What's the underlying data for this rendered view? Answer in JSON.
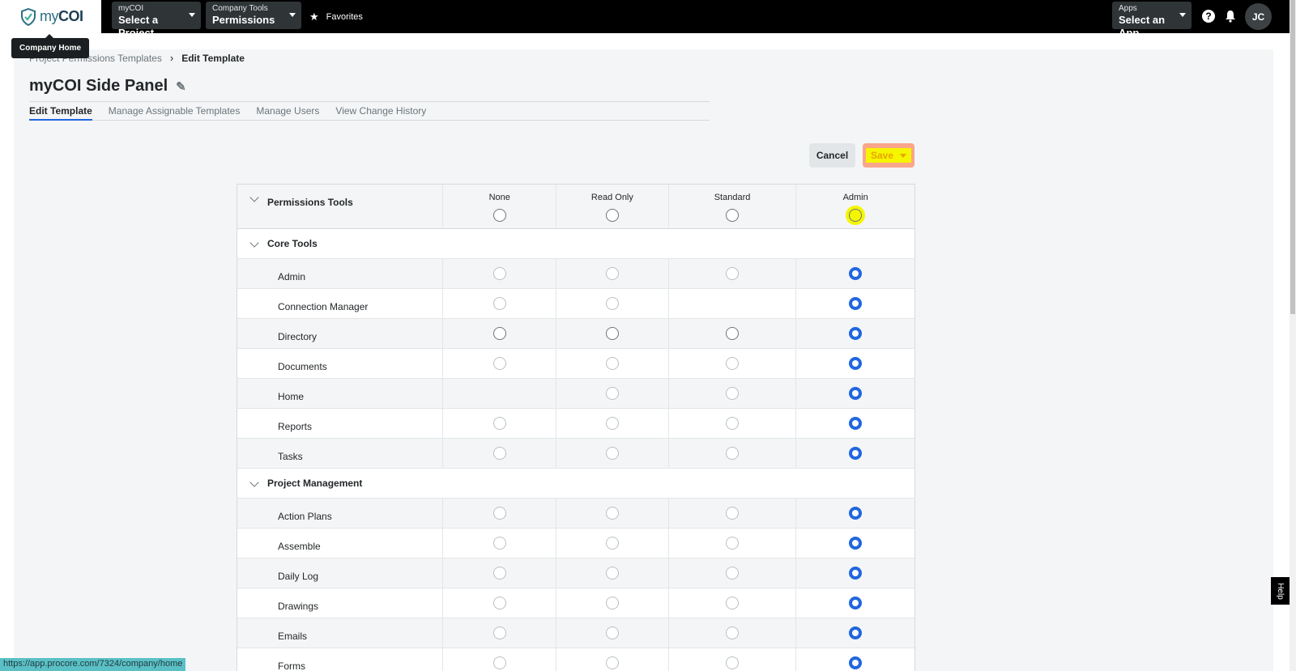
{
  "topbar": {
    "logo_text_light": "my",
    "logo_text_bold": "COI",
    "project_select": {
      "label": "myCOI",
      "value": "Select a Project"
    },
    "tools_select": {
      "label": "Company Tools",
      "value": "Permissions"
    },
    "favorites": "Favorites",
    "apps_select": {
      "label": "Apps",
      "value": "Select an App"
    },
    "help_icon": "?",
    "avatar_initials": "JC"
  },
  "tooltip": "Company Home",
  "breadcrumb": {
    "parent": "Project Permissions Templates",
    "current": "Edit Template"
  },
  "page_title": "myCOI Side Panel",
  "tabs": [
    "Edit Template",
    "Manage Assignable Templates",
    "Manage Users",
    "View Change History"
  ],
  "buttons": {
    "cancel": "Cancel",
    "save": "Save"
  },
  "table": {
    "header_name": "Permissions Tools",
    "levels": [
      "None",
      "Read Only",
      "Standard",
      "Admin"
    ],
    "groups": [
      {
        "name": "Core Tools",
        "tools": [
          "Admin",
          "Connection Manager",
          "Directory",
          "Documents",
          "Home",
          "Reports",
          "Tasks"
        ]
      },
      {
        "name": "Project Management",
        "tools": [
          "Action Plans",
          "Assemble",
          "Daily Log",
          "Drawings",
          "Emails",
          "Forms"
        ]
      }
    ],
    "selected_level": "Admin"
  },
  "status_url": "https://app.procore.com/7324/company/home",
  "help_tab": "Help"
}
